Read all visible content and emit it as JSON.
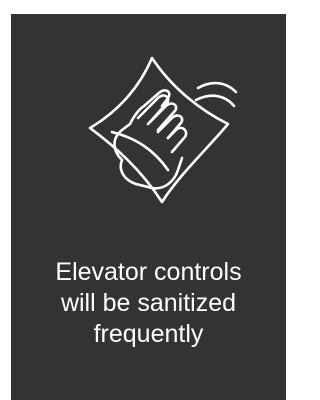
{
  "sign": {
    "background_color": "#333333",
    "text_color": "#ffffff",
    "icon": "hand-wiping-cloth-icon",
    "message_lines": [
      "Elevator controls",
      "will be sanitized",
      "frequently"
    ]
  }
}
